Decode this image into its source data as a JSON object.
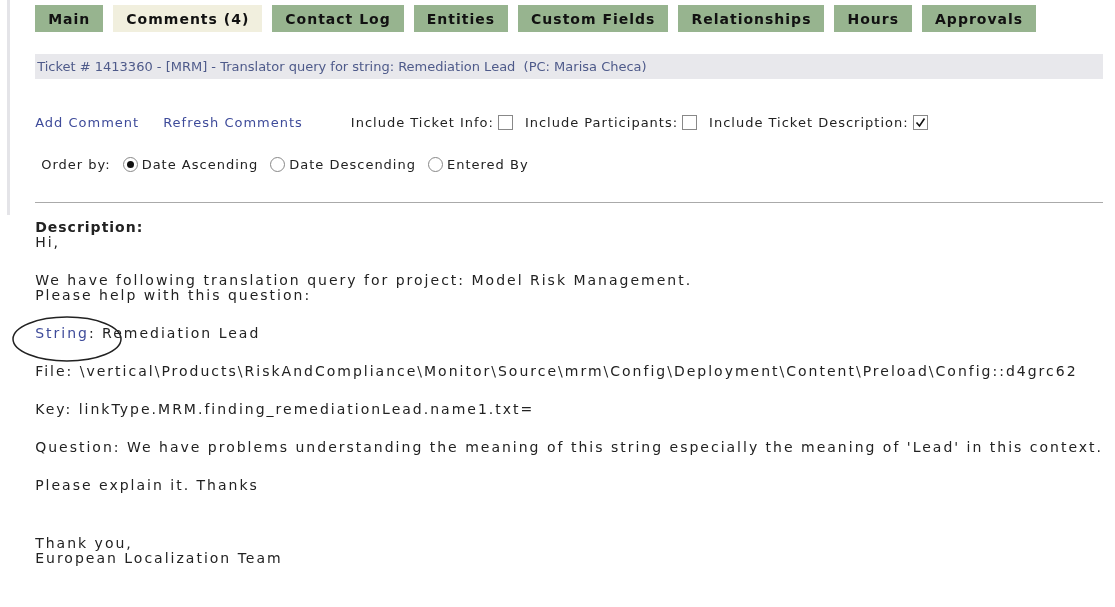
{
  "tabs": [
    {
      "label": "Main",
      "selected": false
    },
    {
      "label": "Comments (4)",
      "selected": true
    },
    {
      "label": "Contact Log",
      "selected": false
    },
    {
      "label": "Entities",
      "selected": false
    },
    {
      "label": "Custom Fields",
      "selected": false
    },
    {
      "label": "Relationships",
      "selected": false
    },
    {
      "label": "Hours",
      "selected": false
    },
    {
      "label": "Approvals",
      "selected": false
    }
  ],
  "ticket_header": "Ticket # 1413360 - [MRM] - Translator query for string: Remediation Lead  (PC: Marisa Checa)",
  "actions": [
    {
      "label": "Add Comment"
    },
    {
      "label": "Refresh Comments"
    }
  ],
  "include_options": [
    {
      "label": "Include Ticket Info:",
      "checked": false
    },
    {
      "label": "Include Participants:",
      "checked": false
    },
    {
      "label": "Include Ticket Description:",
      "checked": true
    }
  ],
  "order_by": {
    "label": "Order by:",
    "options": [
      {
        "label": "Date Ascending",
        "selected": true
      },
      {
        "label": "Date Descending",
        "selected": false
      },
      {
        "label": "Entered By",
        "selected": false
      }
    ]
  },
  "description": {
    "heading": "Description:",
    "paragraphs": [
      {
        "kind": "text",
        "lines": [
          "Hi,"
        ]
      },
      {
        "kind": "text",
        "lines": [
          "We have following translation query for project: Model Risk Management.",
          "Please help with this question:"
        ]
      },
      {
        "kind": "link",
        "link": "String",
        "rest": ": Remediation Lead",
        "circled": true
      },
      {
        "kind": "text",
        "lines": [
          "File: \\vertical\\Products\\RiskAndCompliance\\Monitor\\Source\\mrm\\Config\\Deployment\\Content\\Preload\\Config::d4grc62"
        ]
      },
      {
        "kind": "text",
        "lines": [
          "Key: linkType.MRM.finding_remediationLead.name1.txt="
        ]
      },
      {
        "kind": "text",
        "lines": [
          "Question: We have problems understanding the meaning of this string especially the meaning of 'Lead' in this context."
        ]
      },
      {
        "kind": "text",
        "lines": [
          "Please explain it. Thanks"
        ]
      },
      {
        "kind": "closing",
        "lines": [
          "Thank you,",
          "European Localization Team"
        ]
      }
    ]
  }
}
